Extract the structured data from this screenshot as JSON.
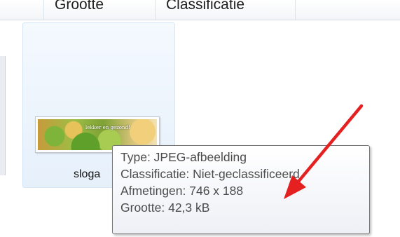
{
  "columns": {
    "size_label": "Grootte",
    "classification_label": "Classificatie"
  },
  "file": {
    "name": "sloga",
    "thumbnail_text": "lekker en gezond!"
  },
  "tooltip": {
    "type_line": "Type: JPEG-afbeelding",
    "classification_line": "Classificatie: Niet-geclassificeerd",
    "dimensions_line": "Afmetingen: 746 x 188",
    "size_line": "Grootte: 42,3 kB"
  },
  "annotation": {
    "arrow_color": "#e52020",
    "icon": "red-arrow-icon"
  }
}
